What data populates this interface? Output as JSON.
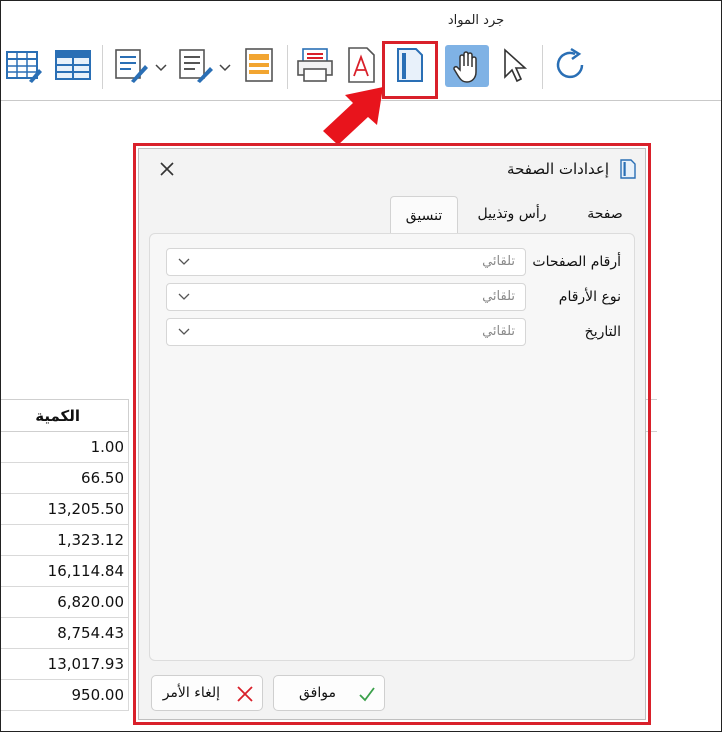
{
  "app": {
    "title": "جرد المواد"
  },
  "toolbar": {
    "buttons": [
      {
        "name": "table-edit-icon"
      },
      {
        "name": "grid-icon"
      },
      {
        "name": "edit-document-icon"
      },
      {
        "name": "format-document-icon"
      },
      {
        "name": "report-icon"
      },
      {
        "name": "print-preview-icon"
      },
      {
        "name": "pdf-icon"
      },
      {
        "name": "page-setup-icon"
      },
      {
        "name": "hand-icon"
      },
      {
        "name": "pointer-icon"
      },
      {
        "name": "refresh-icon"
      }
    ],
    "active_button": "hand-icon",
    "highlighted_button": "page-setup-icon"
  },
  "table": {
    "header": "الكمية",
    "rows": [
      "1.00",
      "66.50",
      "13,205.50",
      "1,323.12",
      "16,114.84",
      "6,820.00",
      "8,754.43",
      "13,017.93",
      "950.00"
    ]
  },
  "dialog": {
    "title": "إعدادات الصفحة",
    "tabs": [
      {
        "label": "صفحة",
        "selected": false
      },
      {
        "label": "رأس وتذييل",
        "selected": false
      },
      {
        "label": "تنسيق",
        "selected": true
      }
    ],
    "fields": [
      {
        "label": "أرقام الصفحات",
        "value": "تلقائي"
      },
      {
        "label": "نوع الأرقام",
        "value": "تلقائي"
      },
      {
        "label": "التاريخ",
        "value": "تلقائي"
      }
    ],
    "ok_label": "موافق",
    "cancel_label": "إلغاء الأمر"
  },
  "colors": {
    "highlight_red": "#d9202a",
    "active_blue": "#7fb2e5",
    "icon_blue": "#2a6fb5",
    "ok_green": "#3aa04a",
    "cancel_red": "#d9202a"
  }
}
